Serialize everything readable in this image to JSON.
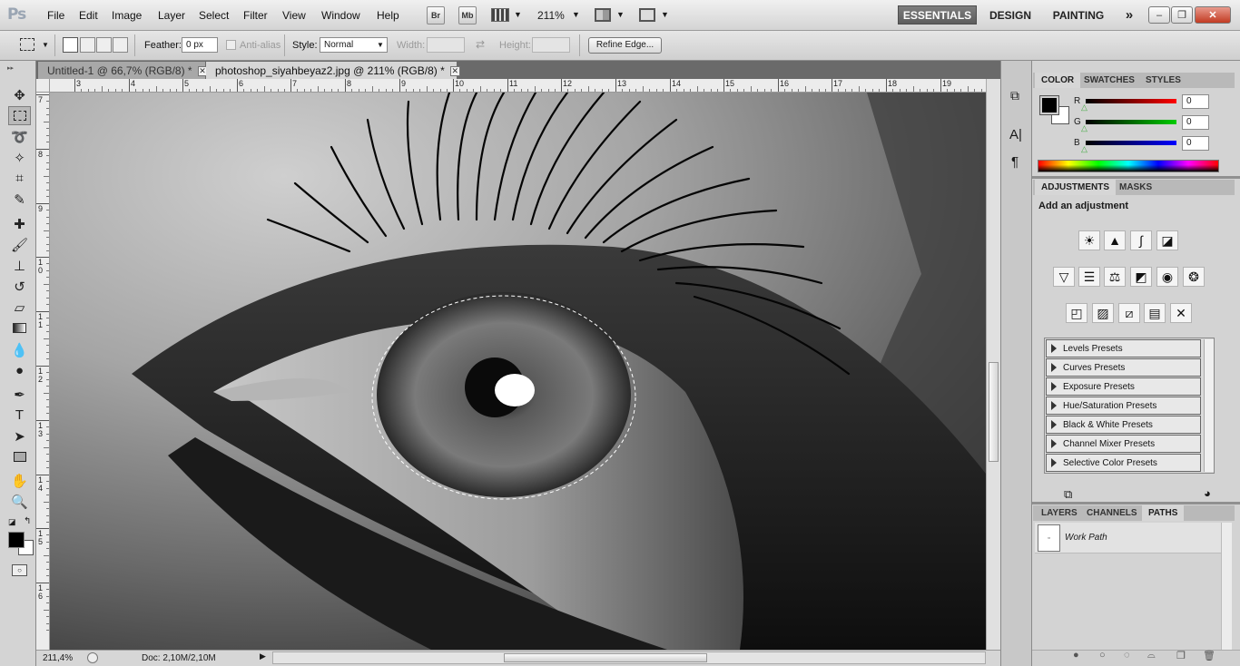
{
  "app": {
    "logo": "Ps"
  },
  "menu": [
    "File",
    "Edit",
    "Image",
    "Layer",
    "Select",
    "Filter",
    "View",
    "Window",
    "Help"
  ],
  "appbar": {
    "bridge": "Br",
    "minibridge": "Mb",
    "zoom": "211%"
  },
  "workspaces": [
    "ESSENTIALS",
    "DESIGN",
    "PAINTING"
  ],
  "workspace_more": "»",
  "window_controls": {
    "minimize": "–",
    "restore": "❐",
    "close": "✕"
  },
  "options": {
    "feather_label": "Feather:",
    "feather_value": "0 px",
    "antialias_label": "Anti-alias",
    "style_label": "Style:",
    "style_value": "Normal",
    "width_label": "Width:",
    "height_label": "Height:",
    "refine_edge": "Refine Edge..."
  },
  "tabs": [
    {
      "title": "Untitled-1 @ 66,7% (RGB/8) *"
    },
    {
      "title": "photoshop_siyahbeyaz2.jpg @ 211% (RGB/8) *"
    }
  ],
  "ruler": {
    "h_ticks": [
      "3",
      "4",
      "5",
      "6",
      "7",
      "8",
      "9",
      "10",
      "11",
      "12",
      "13",
      "14",
      "15",
      "16",
      "17",
      "18",
      "19"
    ],
    "v_ticks": [
      "7",
      "8",
      "9",
      "1\n0",
      "1\n1",
      "1\n2",
      "1\n3",
      "1\n4",
      "1\n5",
      "1\n6"
    ]
  },
  "status": {
    "zoom": "211,4%",
    "doc": "Doc: 2,10M/2,10M"
  },
  "color_panel": {
    "tabs": [
      "COLOR",
      "SWATCHES",
      "STYLES"
    ],
    "channels": [
      {
        "label": "R",
        "value": "0",
        "color": "#ff0000"
      },
      {
        "label": "G",
        "value": "0",
        "color": "#00cc00"
      },
      {
        "label": "B",
        "value": "0",
        "color": "#0000ff"
      }
    ],
    "foreground": "#000000",
    "background": "#ffffff"
  },
  "adjustments_panel": {
    "tabs": [
      "ADJUSTMENTS",
      "MASKS"
    ],
    "heading": "Add an adjustment",
    "presets": [
      "Levels Presets",
      "Curves Presets",
      "Exposure Presets",
      "Hue/Saturation Presets",
      "Black & White Presets",
      "Channel Mixer Presets",
      "Selective Color Presets"
    ]
  },
  "layers_panel": {
    "tabs": [
      "LAYERS",
      "CHANNELS",
      "PATHS"
    ],
    "paths": [
      {
        "name": "Work Path"
      }
    ]
  }
}
